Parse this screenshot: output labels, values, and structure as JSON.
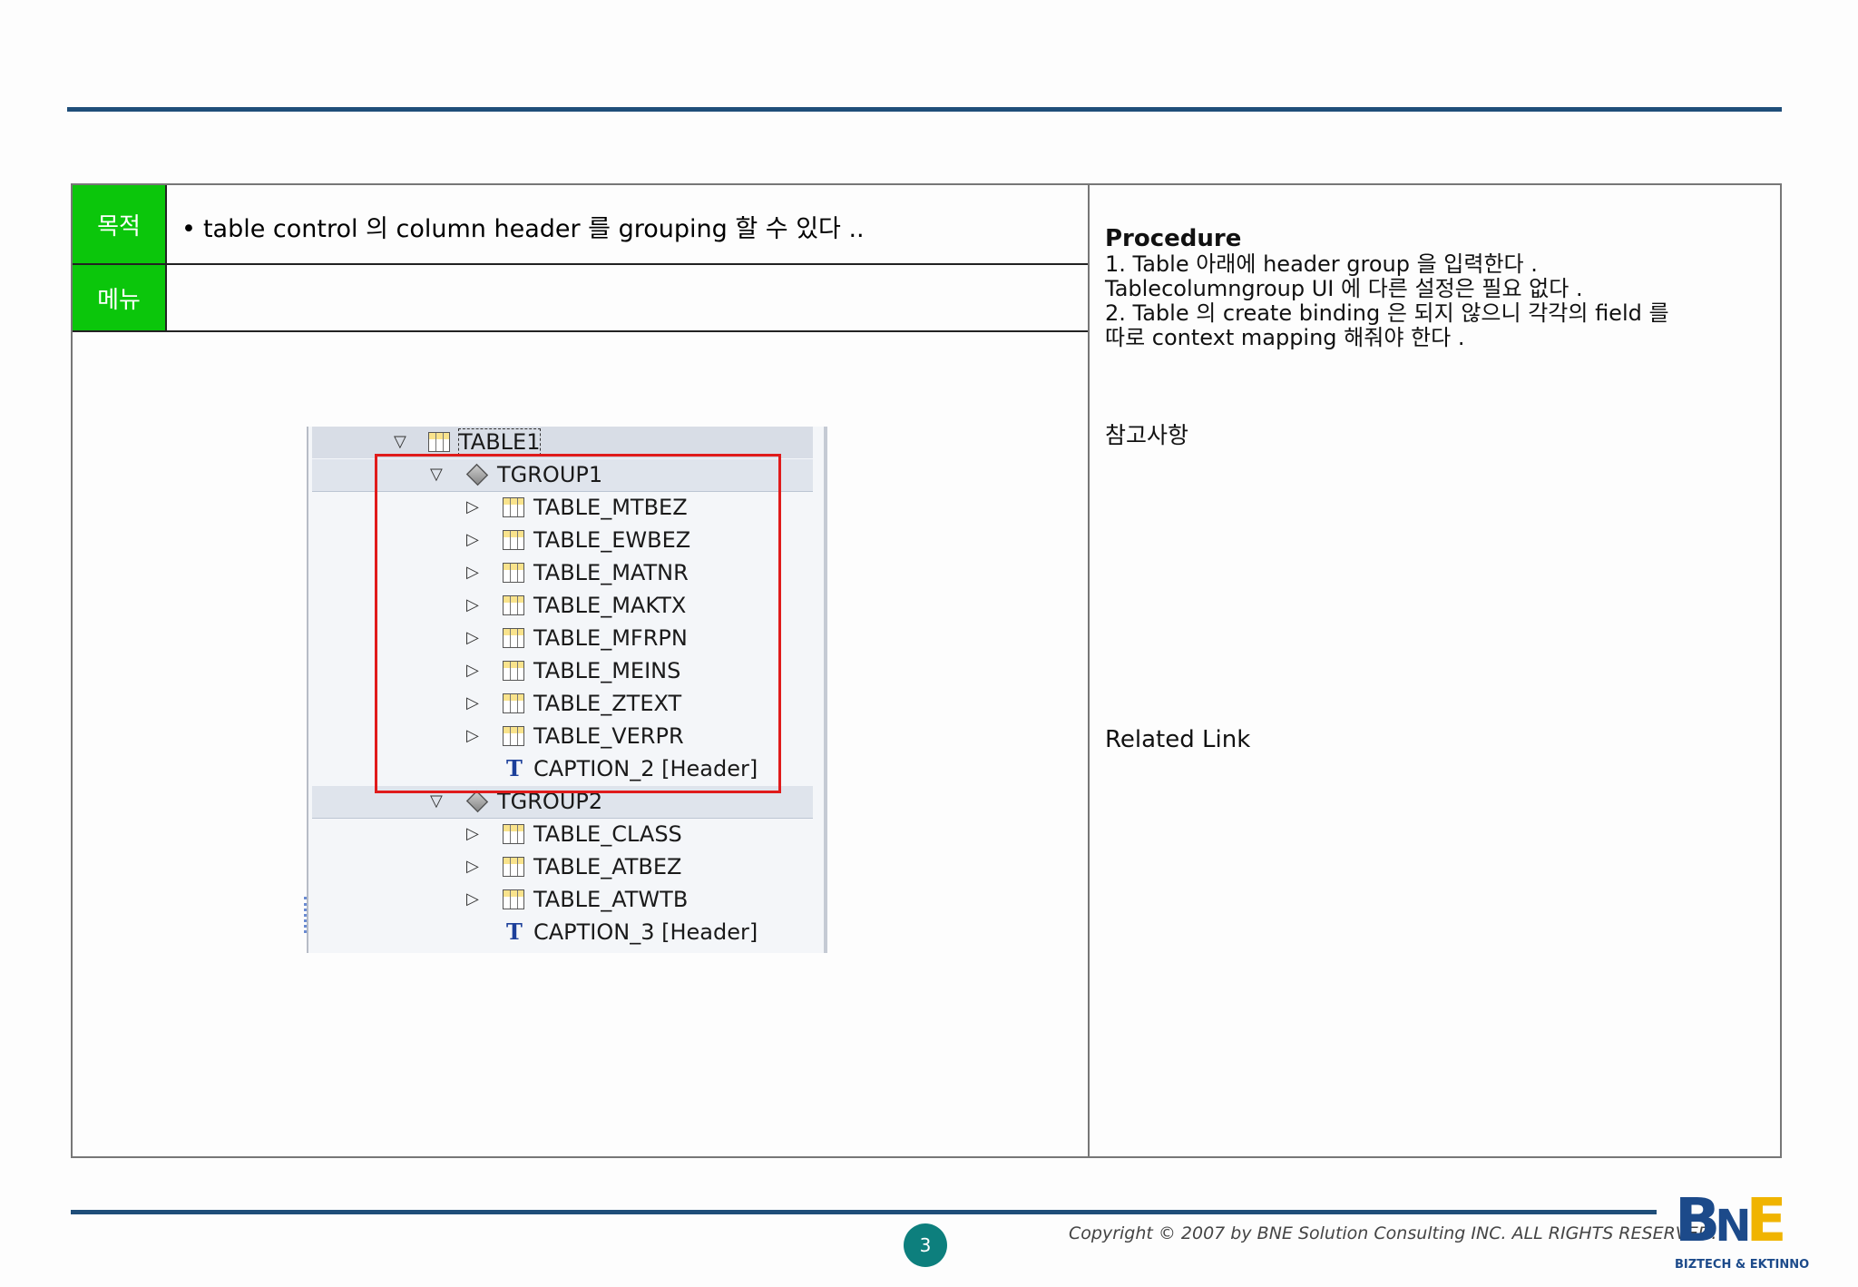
{
  "header": {
    "goal_label": "목적",
    "menu_label": "메뉴",
    "goal_bullet": "•",
    "goal_text": "table control 의  column header 를  grouping  할 수 있다 ..",
    "menu_text": ""
  },
  "right": {
    "procedure_title": "Procedure",
    "procedure_lines": [
      "1. Table  아래에  header group 을 입력한다 .",
      "Tablecolumngroup UI 에 다른 설정은 필요 없다 .",
      "2. Table 의  create binding 은 되지 않으니 각각의  field 를",
      "따로  context mapping  해줘야 한다 ."
    ],
    "reference_title": "참고사항",
    "related_link_title": "Related Link"
  },
  "tree": {
    "root": "TABLE1",
    "groups": [
      {
        "name": "TGROUP1",
        "columns": [
          "TABLE_MTBEZ",
          "TABLE_EWBEZ",
          "TABLE_MATNR",
          "TABLE_MAKTX",
          "TABLE_MFRPN",
          "TABLE_MEINS",
          "TABLE_ZTEXT",
          "TABLE_VERPR"
        ],
        "caption": "CAPTION_2  [Header]"
      },
      {
        "name": "TGROUP2",
        "columns": [
          "TABLE_CLASS",
          "TABLE_ATBEZ",
          "TABLE_ATWTB"
        ],
        "caption": "CAPTION_3  [Header]"
      }
    ],
    "expand_symbol": "▽",
    "collapsed_symbol": "▷",
    "caption_icon": "T"
  },
  "footer": {
    "page_number": "3",
    "copyright": "Copyright © 2007 by BNE Solution Consulting INC.   ALL RIGHTS RESERVED.",
    "logo_b": "B",
    "logo_n": "N",
    "logo_e": "E",
    "logo_sub": "BIZTECH & EKTINNO"
  },
  "colors": {
    "accent_rule": "#1f4e79",
    "label_green": "#0bc60b",
    "selection_red": "#e01b1b",
    "page_badge": "#0d7f7d"
  }
}
